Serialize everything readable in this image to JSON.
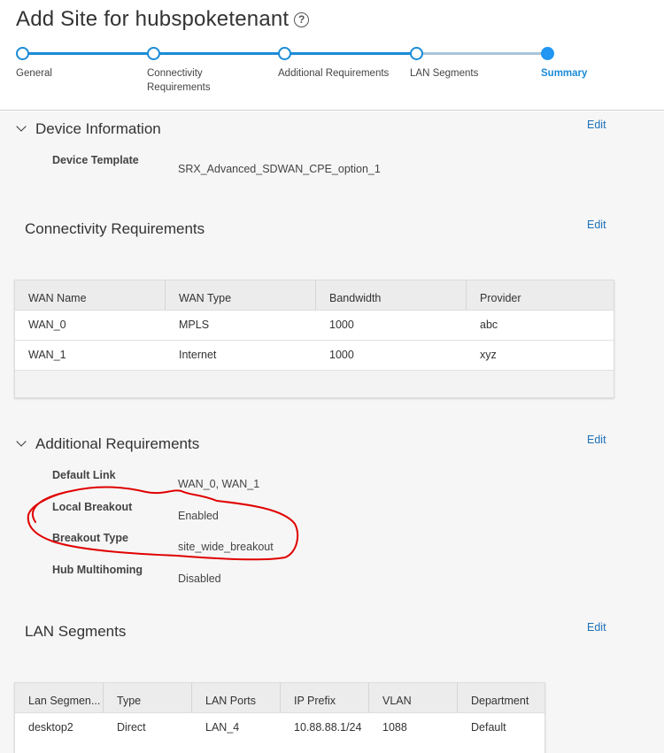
{
  "page": {
    "title": "Add Site for hubspoketenant",
    "help_icon": "?"
  },
  "wizard": {
    "steps": [
      {
        "label": "General",
        "state": "done"
      },
      {
        "label": "Connectivity Requirements",
        "state": "done"
      },
      {
        "label": "Additional Requirements",
        "state": "done"
      },
      {
        "label": "LAN Segments",
        "state": "done"
      },
      {
        "label": "Summary",
        "state": "active"
      }
    ],
    "accent_color": "#1b8bd6"
  },
  "device_information": {
    "heading": "Device Information",
    "edit_label": "Edit",
    "fields": [
      {
        "label": "Device Template",
        "value": "SRX_Advanced_SDWAN_CPE_option_1"
      }
    ]
  },
  "connectivity": {
    "heading": "Connectivity Requirements",
    "edit_label": "Edit",
    "columns": [
      "WAN Name",
      "WAN Type",
      "Bandwidth",
      "Provider"
    ],
    "rows": [
      [
        "WAN_0",
        "MPLS",
        "1000",
        "abc"
      ],
      [
        "WAN_1",
        "Internet",
        "1000",
        "xyz"
      ]
    ]
  },
  "additional": {
    "heading": "Additional Requirements",
    "edit_label": "Edit",
    "fields": [
      {
        "label": "Default Link",
        "value": "WAN_0, WAN_1"
      },
      {
        "label": "Local Breakout",
        "value": "Enabled"
      },
      {
        "label": "Breakout Type",
        "value": "site_wide_breakout"
      },
      {
        "label": "Hub Multihoming",
        "value": "Disabled"
      }
    ]
  },
  "lan_segments": {
    "heading": "LAN Segments",
    "edit_label": "Edit",
    "columns": [
      "Lan Segmen...",
      "Type",
      "LAN Ports",
      "IP Prefix",
      "VLAN",
      "Department"
    ],
    "rows": [
      [
        "desktop2",
        "Direct",
        "LAN_4",
        "10.88.88.1/24",
        "1088",
        "Default"
      ]
    ]
  },
  "annotation_color": "#e00000"
}
